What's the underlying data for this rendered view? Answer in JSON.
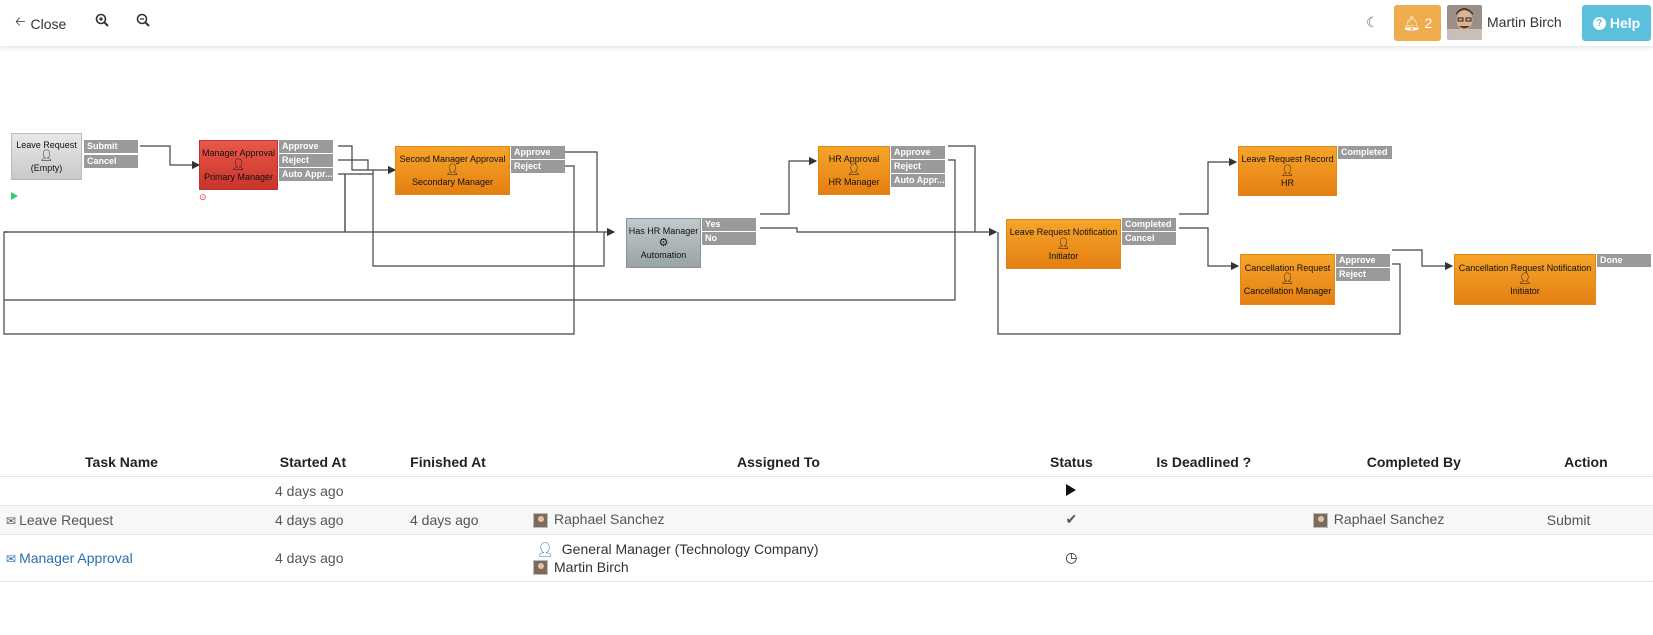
{
  "toolbar": {
    "close_label": "Close",
    "notif_count": "2",
    "user_name": "Martin Birch",
    "help_label": "Help"
  },
  "flow": {
    "nodes": {
      "leave_request": {
        "title": "Leave Request",
        "sub": "(Empty)"
      },
      "manager_approval": {
        "title": "Manager Approval",
        "sub": "Primary Manager"
      },
      "second_manager": {
        "title": "Second Manager Approval",
        "sub": "Secondary Manager"
      },
      "has_hr": {
        "title": "Has HR Manager",
        "sub": "Automation"
      },
      "hr_approval": {
        "title": "HR Approval",
        "sub": "HR Manager"
      },
      "notification": {
        "title": "Leave Request Notification",
        "sub": "Initiator"
      },
      "record": {
        "title": "Leave Request Record",
        "sub": "HR"
      },
      "cancel_req": {
        "title": "Cancellation Request",
        "sub": "Cancellation Manager"
      },
      "cancel_notif": {
        "title": "Cancellation Request Notification",
        "sub": "Initiator"
      }
    },
    "outputs": {
      "submit": "Submit",
      "cancel": "Cancel",
      "approve": "Approve",
      "reject": "Reject",
      "auto_appr": "Auto Appr...",
      "yes": "Yes",
      "no": "No",
      "completed": "Completed",
      "done": "Done"
    }
  },
  "table": {
    "headers": [
      "Task Name",
      "Started At",
      "Finished At",
      "Assigned To",
      "Status",
      "Is Deadlined ?",
      "Completed By",
      "Action"
    ],
    "rows": [
      {
        "task": "",
        "started": "4 days ago",
        "finished": "",
        "assigned": [],
        "status_icon": "play-icon",
        "completed_by": "",
        "action": ""
      },
      {
        "task": "Leave Request",
        "started": "4 days ago",
        "finished": "4 days ago",
        "assigned": [
          "Raphael Sanchez"
        ],
        "status_icon": "check-icon",
        "completed_by": "Raphael Sanchez",
        "action": "Submit"
      },
      {
        "task": "Manager Approval",
        "started": "4 days ago",
        "finished": "",
        "assigned": [
          "General Manager (Technology Company)",
          "Martin Birch"
        ],
        "status_icon": "clock-icon",
        "completed_by": "",
        "action": ""
      }
    ]
  }
}
